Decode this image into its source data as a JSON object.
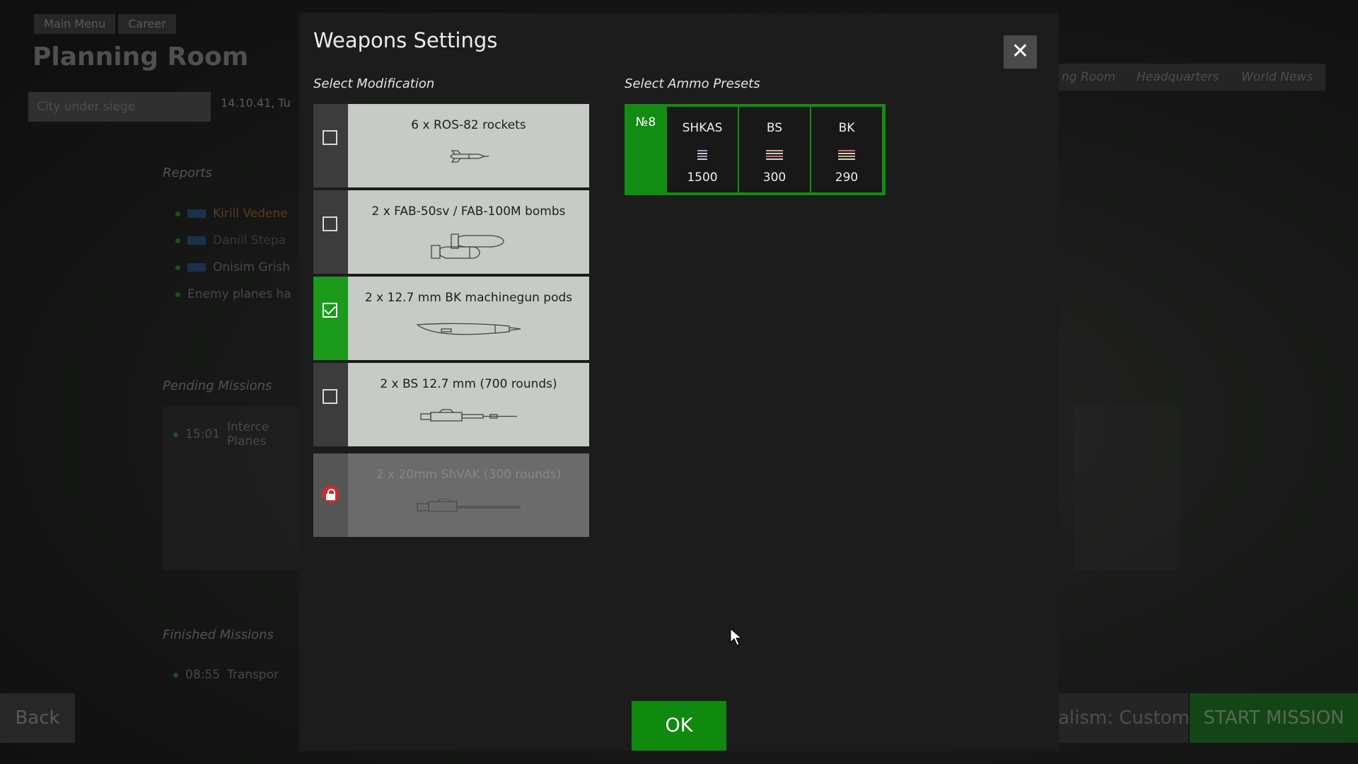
{
  "background": {
    "breadcrumb": [
      "Main Menu",
      "Career"
    ],
    "title": "Planning Room",
    "campaign_field": "City under siege",
    "date": "14.10.41, Tu",
    "reports_label": "Reports",
    "reports": [
      "Kirill Vedene",
      "Daniil Stepa",
      "Onisim Grish",
      "Enemy planes ha"
    ],
    "pending_label": "Pending Missions",
    "pending": [
      {
        "time": "15:01",
        "text": "Interce Planes"
      }
    ],
    "finished_label": "Finished Missions",
    "finished": [
      {
        "time": "08:55",
        "text": "Transpor"
      }
    ],
    "tabs": [
      "ng Room",
      "Headquarters",
      "World News"
    ],
    "back_label": "Back",
    "realism_label": "alism: Custom",
    "start_label": "START MISSION"
  },
  "dialog": {
    "title": "Weapons Settings",
    "close_glyph": "✕",
    "modification_label": "Select Modification",
    "ammo_label": "Select Ammo Presets",
    "modifications": [
      {
        "label": "6 x ROS-82 rockets",
        "state": "unchecked",
        "icon": "rocket-icon"
      },
      {
        "label": "2 x FAB-50sv / FAB-100M bombs",
        "state": "unchecked",
        "icon": "bombs-icon"
      },
      {
        "label": "2 x 12.7 mm BK machinegun pods",
        "state": "checked",
        "icon": "gun-pod-icon"
      },
      {
        "label": "2 x BS 12.7 mm (700 rounds)",
        "state": "unchecked",
        "icon": "machinegun-icon"
      },
      {
        "label": "2 x 20mm ShVAK (300 rounds)",
        "state": "locked",
        "icon": "cannon-icon"
      }
    ],
    "preset": {
      "number": "№8",
      "columns": [
        {
          "name": "SHKAS",
          "count": "1500"
        },
        {
          "name": "BS",
          "count": "300"
        },
        {
          "name": "BK",
          "count": "290"
        }
      ]
    },
    "ok_label": "OK"
  },
  "colors": {
    "accent_green": "#128c12",
    "lock_red": "#c52f2f",
    "card_bg": "#c6cbc6"
  }
}
